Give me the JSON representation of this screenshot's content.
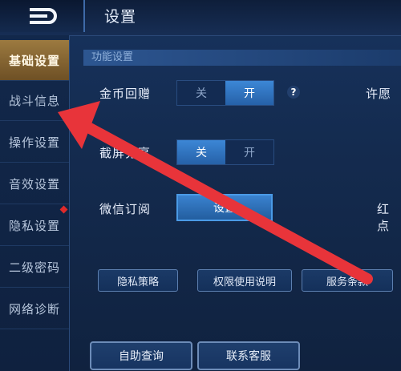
{
  "header": {
    "title": "设置",
    "back_icon": "back-arrow-icon"
  },
  "sidebar": {
    "items": [
      {
        "label": "基础设置",
        "active": true
      },
      {
        "label": "战斗信息"
      },
      {
        "label": "操作设置"
      },
      {
        "label": "音效设置"
      },
      {
        "label": "隐私设置",
        "badge": "red-dot"
      },
      {
        "label": "二级密码"
      },
      {
        "label": "网络诊断"
      }
    ]
  },
  "main": {
    "section_title": "功能设置",
    "coin_gift": {
      "label": "金币回赠",
      "off": "关",
      "on": "开",
      "selected": "开",
      "help": "?"
    },
    "wish_label": "许愿",
    "screenshot_share": {
      "label": "截屏分享",
      "off": "关",
      "on": "开",
      "selected": "关"
    },
    "wechat_sub": {
      "label": "微信订阅",
      "button": "设置"
    },
    "red_dot_label": "红点",
    "links": [
      "隐私策略",
      "权限使用说明",
      "服务条款"
    ],
    "bottom": [
      "自助查询",
      "联系客服"
    ]
  },
  "colors": {
    "accent_blue": "#3c87d6",
    "active_gold": "#9c7a40",
    "annotation_red": "#e8343a"
  }
}
